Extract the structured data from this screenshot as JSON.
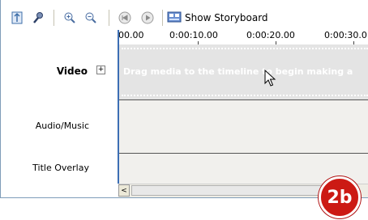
{
  "toolbar": {
    "storyboard_label": "Show Storyboard",
    "icons": [
      "narration-icon",
      "audio-levels-icon",
      "zoom-in-icon",
      "zoom-out-icon",
      "rewind-icon",
      "play-icon",
      "storyboard-icon"
    ]
  },
  "ruler": {
    "labels": [
      "00.00",
      "0:00:10.00",
      "0:00:20.00",
      "0:00:30.0"
    ]
  },
  "tracks": {
    "video_label": "Video",
    "video_hint": "Drag media to the timeline to begin making a",
    "audio_label": "Audio/Music",
    "title_label": "Title Overlay",
    "expand_symbol": "+"
  },
  "scrollbar": {
    "left_arrow": "<"
  },
  "badge": {
    "text": "2b"
  },
  "colors": {
    "badge": "#cc1a14",
    "timeline_bg": "#f1f0ed",
    "video_track_bg": "#e4e4e4",
    "divider": "#3c6eb4"
  }
}
